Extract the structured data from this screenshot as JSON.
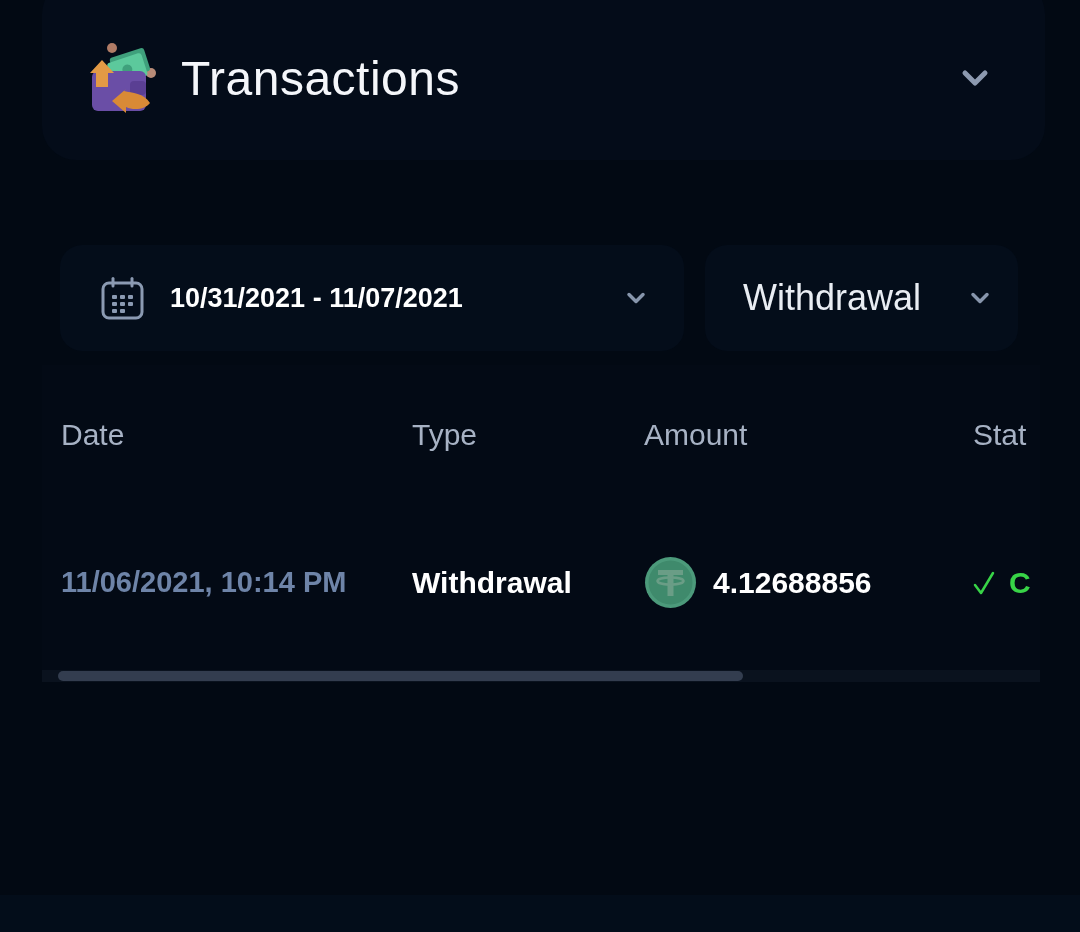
{
  "header": {
    "title": "Transactions"
  },
  "filters": {
    "date_range": {
      "value": "10/31/2021 - 11/07/2021"
    },
    "type": {
      "value": "Withdrawal"
    }
  },
  "table": {
    "columns": [
      "Date",
      "Type",
      "Amount",
      "Stat"
    ],
    "rows": [
      {
        "date": "11/06/2021, 10:14 PM",
        "type": "Withdrawal",
        "amount": "4.12688856",
        "status": "C"
      }
    ]
  }
}
